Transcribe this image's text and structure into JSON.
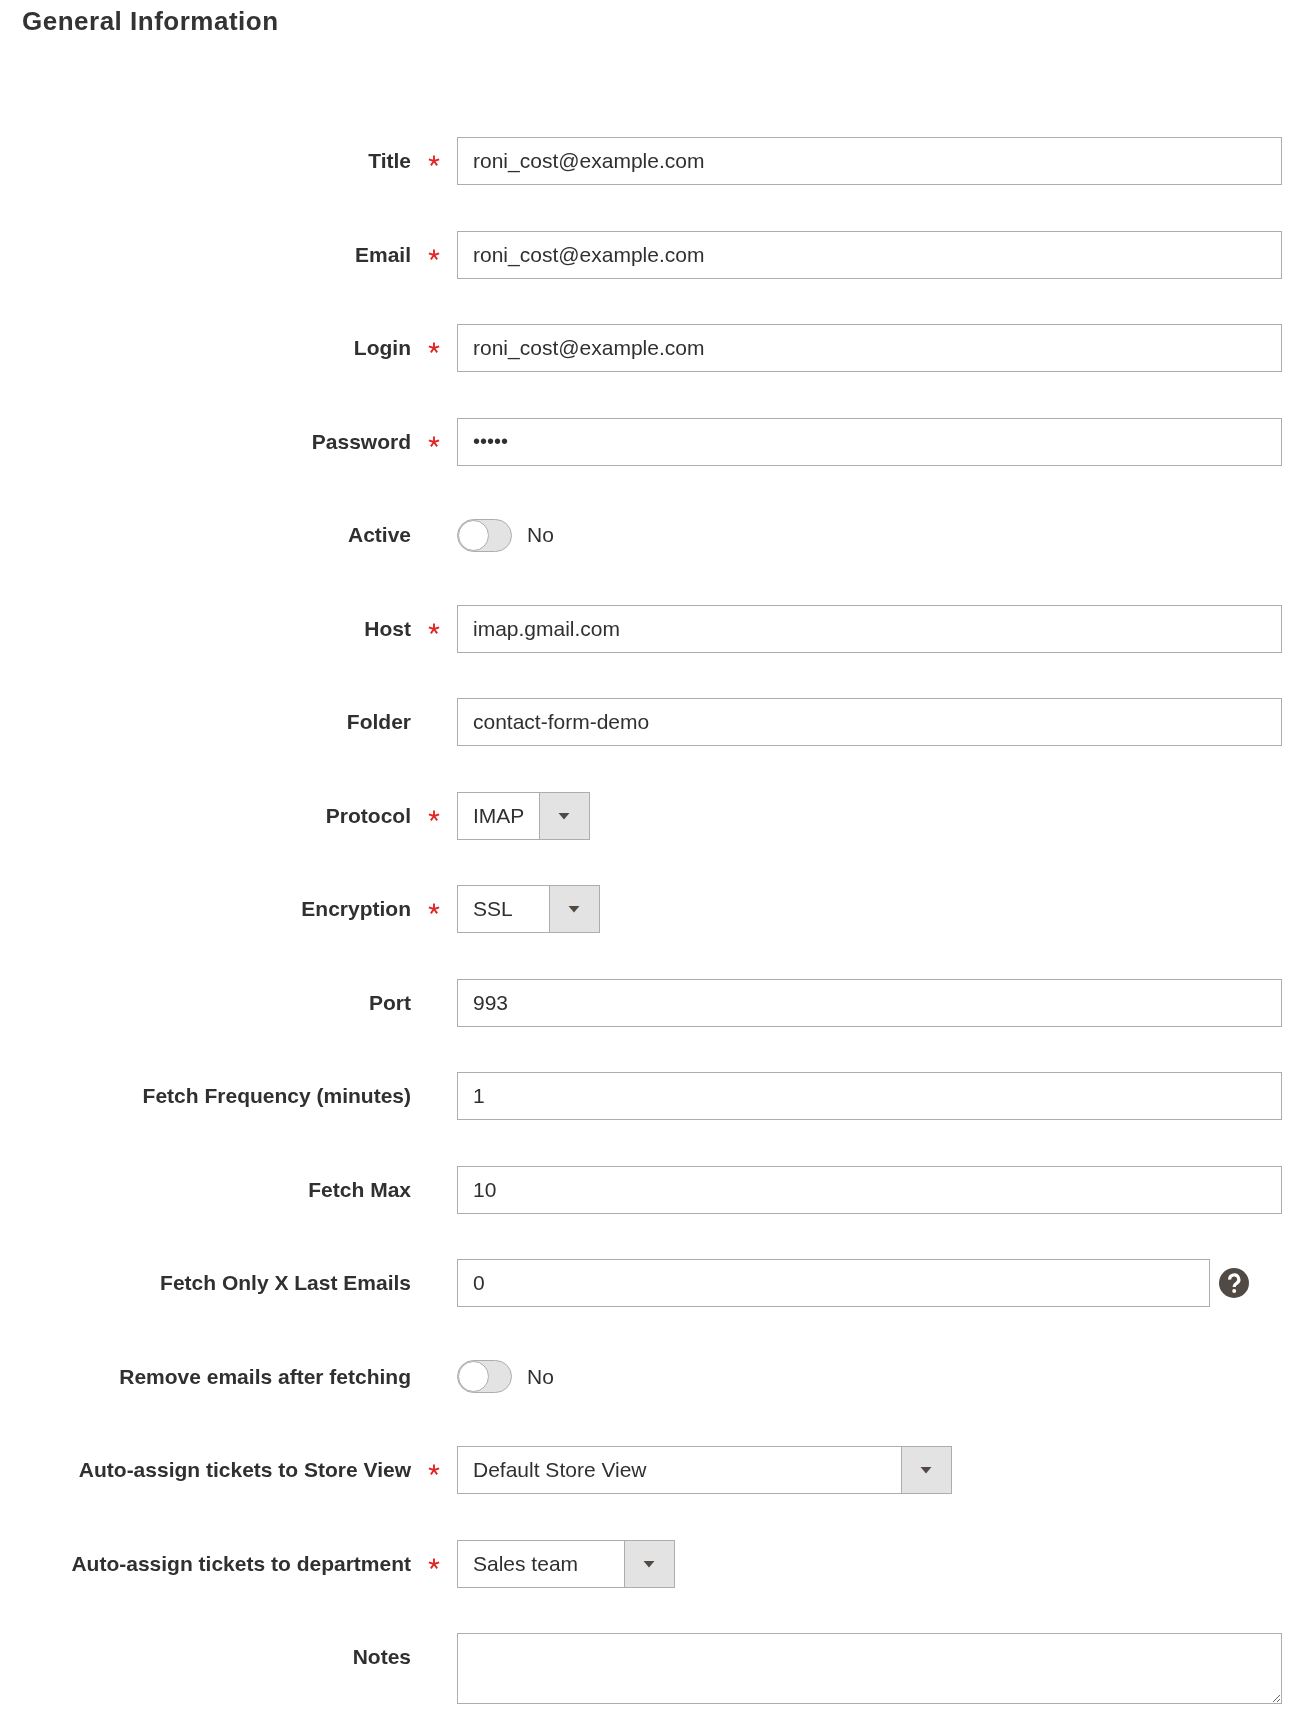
{
  "section_title": "General Information",
  "fields": [
    {
      "kind": "text",
      "label": "Title",
      "required": true,
      "help": false,
      "value": "roni_cost@example.com"
    },
    {
      "kind": "text",
      "label": "Email",
      "required": true,
      "help": false,
      "value": "roni_cost@example.com"
    },
    {
      "kind": "text",
      "label": "Login",
      "required": true,
      "help": false,
      "value": "roni_cost@example.com"
    },
    {
      "kind": "password",
      "label": "Password",
      "required": true,
      "help": false,
      "value": "•••••"
    },
    {
      "kind": "toggle",
      "label": "Active",
      "required": false,
      "help": false,
      "on": false,
      "state_label": "No"
    },
    {
      "kind": "text",
      "label": "Host",
      "required": true,
      "help": false,
      "value": "imap.gmail.com"
    },
    {
      "kind": "text",
      "label": "Folder",
      "required": false,
      "help": false,
      "value": "contact-form-demo"
    },
    {
      "kind": "select",
      "label": "Protocol",
      "required": true,
      "help": false,
      "value": "IMAP"
    },
    {
      "kind": "select",
      "label": "Encryption",
      "required": true,
      "help": false,
      "value": "SSL"
    },
    {
      "kind": "text",
      "label": "Port",
      "required": false,
      "help": false,
      "value": "993"
    },
    {
      "kind": "text",
      "label": "Fetch Frequency (minutes)",
      "required": false,
      "help": false,
      "value": "1"
    },
    {
      "kind": "text",
      "label": "Fetch Max",
      "required": false,
      "help": false,
      "value": "10"
    },
    {
      "kind": "text",
      "label": "Fetch Only X Last Emails",
      "required": false,
      "help": true,
      "value": "0"
    },
    {
      "kind": "toggle",
      "label": "Remove emails after fetching",
      "required": false,
      "help": false,
      "on": false,
      "state_label": "No"
    },
    {
      "kind": "select",
      "label": "Auto-assign tickets to Store View",
      "required": true,
      "help": false,
      "value": "Default Store View"
    },
    {
      "kind": "select",
      "label": "Auto-assign tickets to department",
      "required": true,
      "help": false,
      "value": "Sales team"
    },
    {
      "kind": "textarea",
      "label": "Notes",
      "required": false,
      "help": false
    }
  ]
}
